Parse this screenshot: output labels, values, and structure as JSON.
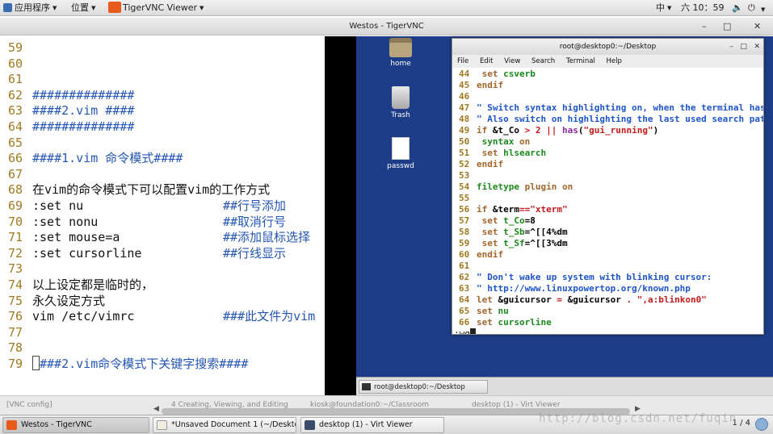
{
  "top_panel": {
    "applications": "应用程序",
    "places": "位置",
    "active_app": "TigerVNC Viewer",
    "ime": "中",
    "clock": "六 10：59"
  },
  "window_title": "Westos - TigerVNC",
  "left_editor": {
    "lines": [
      {
        "n": "59",
        "text": "",
        "comment": ""
      },
      {
        "n": "60",
        "text": "",
        "comment": ""
      },
      {
        "n": "61",
        "text": "",
        "comment": ""
      },
      {
        "n": "62",
        "text": "##############",
        "comment": ""
      },
      {
        "n": "63",
        "text": "####2.vim ####",
        "comment": ""
      },
      {
        "n": "64",
        "text": "##############",
        "comment": ""
      },
      {
        "n": "65",
        "text": "",
        "comment": ""
      },
      {
        "n": "66",
        "text": "####1.vim 命令模式####",
        "comment": ""
      },
      {
        "n": "67",
        "text": "",
        "comment": ""
      },
      {
        "n": "68",
        "text": "在vim的命令模式下可以配置vim的工作方式",
        "comment": ""
      },
      {
        "n": "69",
        "text": ":set nu",
        "comment": "##行号添加"
      },
      {
        "n": "70",
        "text": ":set nonu",
        "comment": "##取消行号"
      },
      {
        "n": "71",
        "text": ":set mouse=a",
        "comment": "##添加鼠标选择"
      },
      {
        "n": "72",
        "text": ":set cursorline",
        "comment": "##行线显示"
      },
      {
        "n": "73",
        "text": "",
        "comment": ""
      },
      {
        "n": "74",
        "text": "以上设定都是临时的，",
        "comment": ""
      },
      {
        "n": "75",
        "text": "永久设定方式",
        "comment": ""
      },
      {
        "n": "76",
        "text": "vim /etc/vimrc",
        "comment": "###此文件为vim"
      },
      {
        "n": "77",
        "text": "",
        "comment": ""
      },
      {
        "n": "78",
        "text": "",
        "comment": ""
      },
      {
        "n": "79",
        "text": "###2.vim命令模式下关键字搜索####",
        "comment": ""
      }
    ]
  },
  "desktop_icons": [
    {
      "label": "home",
      "icon": "home-folder-icon"
    },
    {
      "label": "Trash",
      "icon": "trash-icon"
    },
    {
      "label": "passwd",
      "icon": "file-icon"
    }
  ],
  "terminal": {
    "title": "root@desktop0:~/Desktop",
    "menu": [
      "File",
      "Edit",
      "View",
      "Search",
      "Terminal",
      "Help"
    ],
    "cmdline": ":wq"
  },
  "remote_taskbar": {
    "task": "root@desktop0:~/Desktop"
  },
  "behind_tabs": [
    "[VNC config]",
    "4 Creating, Viewing, and Editing",
    "kiosk@foundation0:~/Classroom",
    "desktop (1) - Virt Viewer"
  ],
  "taskbar": {
    "tasks": [
      "Westos - TigerVNC",
      "*Unsaved Document 1 (~/Deskto…",
      "desktop (1) - Virt Viewer"
    ],
    "pager": "1 / 4"
  },
  "watermark": "http://blog.csdn.net/fuqin"
}
